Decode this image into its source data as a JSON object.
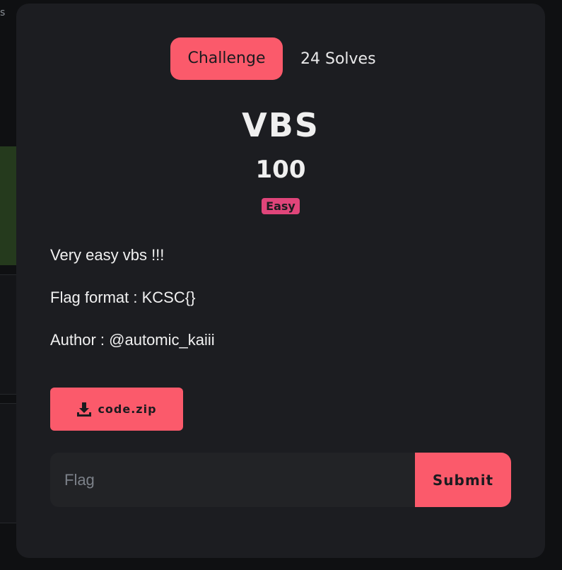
{
  "background": {
    "edge_text": "s"
  },
  "modal": {
    "tabs": [
      {
        "label": "Challenge",
        "active": true
      },
      {
        "label": "24 Solves",
        "active": false
      }
    ],
    "title": "VBS",
    "points": "100",
    "difficulty": "Easy",
    "description": [
      "Very easy vbs !!!",
      "Flag format : KCSC{}",
      "Author : @automic_kaiii"
    ],
    "attachment": {
      "label": "code.zip",
      "icon": "download-icon"
    },
    "flag_form": {
      "placeholder": "Flag",
      "value": "",
      "submit_label": "Submit"
    }
  },
  "colors": {
    "accent": "#fb5a6b",
    "badge": "#e0457a",
    "modal_bg": "#1c1d21",
    "page_bg": "#0f1012"
  }
}
